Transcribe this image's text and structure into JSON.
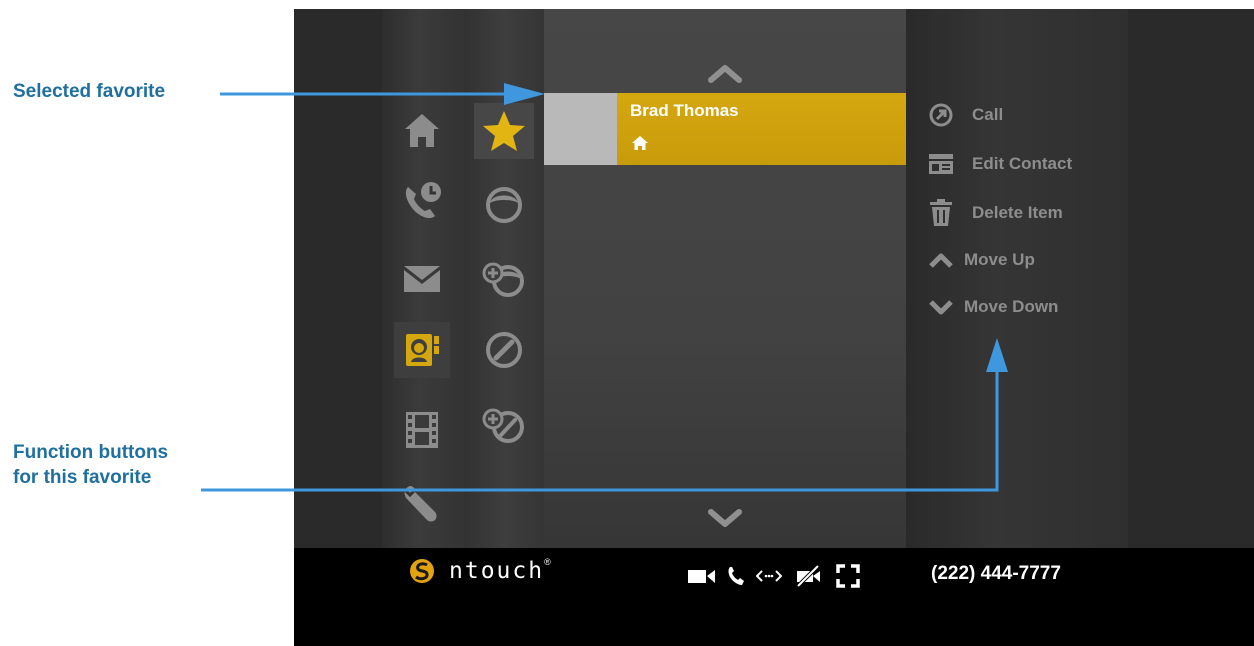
{
  "annotations": {
    "selected_favorite": "Selected favorite",
    "function_buttons_line1": "Function buttons",
    "function_buttons_line2": "for this favorite"
  },
  "nav": {
    "items": [
      {
        "icon": "home-icon",
        "active": false
      },
      {
        "icon": "call-history-icon",
        "active": false
      },
      {
        "icon": "mail-icon",
        "active": false
      },
      {
        "icon": "contacts-book-icon",
        "active": true
      },
      {
        "icon": "video-film-icon",
        "active": false
      },
      {
        "icon": "wrench-icon",
        "active": false
      }
    ]
  },
  "subnav": {
    "items": [
      {
        "icon": "star-icon",
        "active": true
      },
      {
        "icon": "person-icon",
        "active": false
      },
      {
        "icon": "add-person-icon",
        "active": false
      },
      {
        "icon": "blocked-icon",
        "active": false
      },
      {
        "icon": "add-blocked-icon",
        "active": false
      }
    ]
  },
  "favorites": {
    "selected_name": "Brad Thomas",
    "selected_type_icon": "home-icon"
  },
  "actions": [
    {
      "label": "Call",
      "icon": "call-circle-icon"
    },
    {
      "label": "Edit Contact",
      "icon": "contact-card-icon"
    },
    {
      "label": "Delete Item",
      "icon": "trash-icon"
    },
    {
      "label": "Move Up",
      "icon": "chevron-up-icon"
    },
    {
      "label": "Move Down",
      "icon": "chevron-down-icon"
    }
  ],
  "status": {
    "brand": "ntouch",
    "brand_mark": "®",
    "icons": [
      "camera-icon",
      "phone-icon",
      "signal-icon",
      "no-video-privacy-icon",
      "fullscreen-icon"
    ],
    "phone_number": "(222) 444-7777"
  },
  "colors": {
    "accent_yellow": "#d5a70f",
    "callout_blue": "#1f6fa0",
    "arrow_blue": "#3f97de"
  }
}
